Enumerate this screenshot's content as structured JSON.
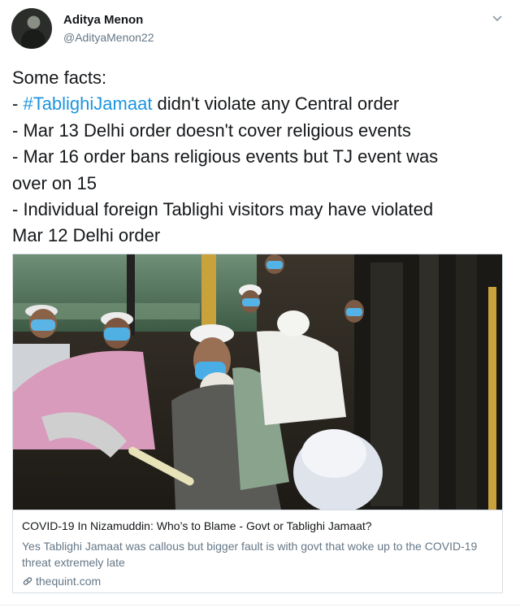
{
  "tweet": {
    "author_name": "Aditya Menon",
    "author_handle": "@AdityaMenon22",
    "text_lines": [
      "Some facts:",
      "- ",
      "#TablighiJamaat",
      " didn't violate any Central order",
      "- Mar 13 Delhi order doesn't cover religious events",
      "- Mar 16 order bans religious events but TJ event was",
      "over on 15",
      "- Individual foreign Tablighi visitors may have violated",
      "Mar 12 Delhi order"
    ]
  },
  "card": {
    "title": "COVID-19 In Nizamuddin: Who’s to Blame - Govt or Tablighi Jamaat?",
    "description": "Yes Tablighi Jamaat was callous but bigger fault is with govt that woke up to the COVID-19 threat extremely late",
    "domain": "thequint.com"
  },
  "colors": {
    "hashtag": "#1b95e0",
    "text": "#14171a",
    "secondary": "#657786",
    "border": "#d6dde3"
  },
  "icons": [
    "chevron-down-icon",
    "link-icon",
    "avatar"
  ]
}
